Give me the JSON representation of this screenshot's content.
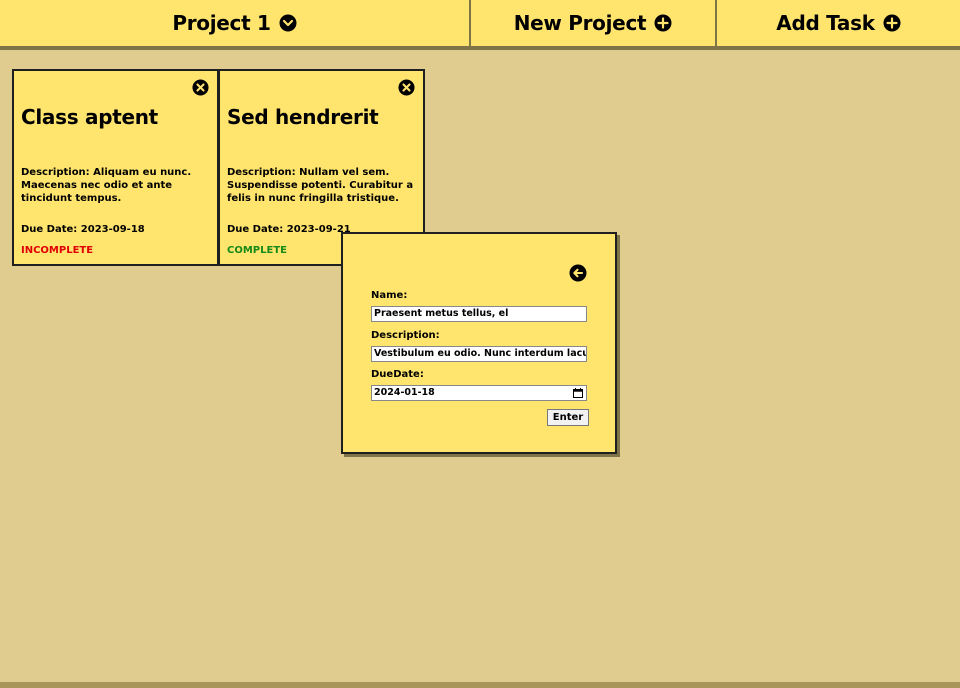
{
  "header": {
    "project_label": "Project 1",
    "project_icon": "chevron-down-circle-icon",
    "new_project_label": "New Project",
    "new_project_icon": "plus-circle-icon",
    "add_task_label": "Add Task",
    "add_task_icon": "plus-circle-icon"
  },
  "tasks": [
    {
      "title": "Class aptent",
      "description": "Description: Aliquam eu nunc. Maecenas nec odio et ante tincidunt tempus.",
      "due": "Due Date: 2023-09-18",
      "status": "INCOMPLETE",
      "status_color": "#e00000"
    },
    {
      "title": "Sed hendrerit",
      "description": "Description: Nullam vel sem. Suspendisse potenti. Curabitur a felis in nunc fringilla tristique.",
      "due": "Due Date: 2023-09-21",
      "status": "COMPLETE",
      "status_color": "#168a16"
    }
  ],
  "modal": {
    "name_label": "Name:",
    "name_value": "Praesent metus tellus, el",
    "description_label": "Description:",
    "description_value": "Vestibulum eu odio. Nunc interdum lacus",
    "duedate_label": "DueDate:",
    "duedate_value": "2024-01-18",
    "enter_label": "Enter"
  },
  "colors": {
    "background": "#e0cc8e",
    "card": "#ffe56e",
    "shadow": "#7f7448"
  }
}
